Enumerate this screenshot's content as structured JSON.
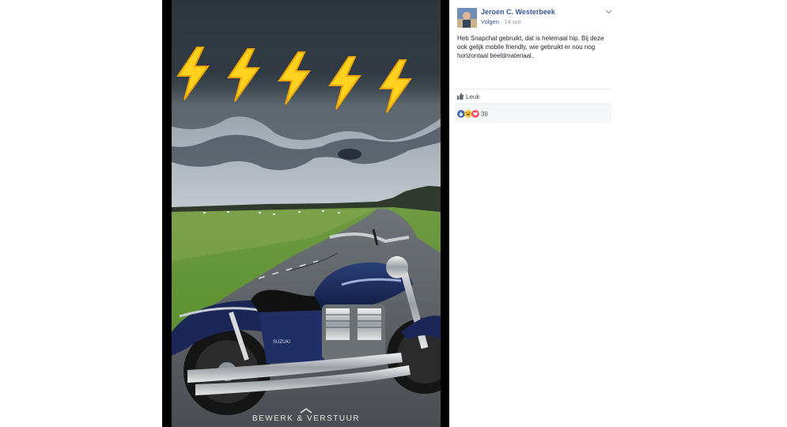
{
  "photo": {
    "edit_send_label": "BEWERK & VERSTUUR",
    "emoji_name": "lightning-bolt-emoji",
    "emoji_count": 5,
    "badge_text": "SUZUKI"
  },
  "post": {
    "author": "Jeroen C. Westerbeek",
    "follow_label": "Volgen",
    "separator": "·",
    "timestamp": "14 uur",
    "text": "Heb Snapchat gebruikt, dat is helemaal hip. Bij deze ook gelijk mobile friendly, wie gebruikt er nou nog horizontaal beeldmateriaal..",
    "like_label": "Leuk",
    "reaction_count": "38",
    "reactions": [
      "like",
      "haha",
      "love"
    ]
  },
  "colors": {
    "link": "#365899",
    "meta": "#90949c",
    "like_blue": "#4267b2",
    "haha_yellow": "#f7c538",
    "love_red": "#f25268"
  }
}
